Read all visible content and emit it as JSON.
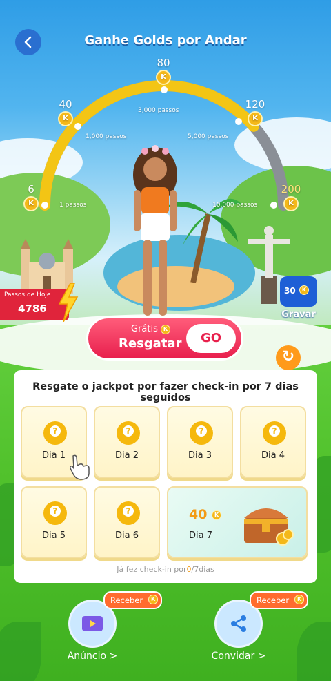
{
  "header": {
    "title": "Ganhe Golds por Andar"
  },
  "coin_symbol": "K",
  "milestones": [
    {
      "reward": "6",
      "steps": "1 passos"
    },
    {
      "reward": "40",
      "steps": "1,000 passos"
    },
    {
      "reward": "80",
      "steps": "3,000 passos"
    },
    {
      "reward": "120",
      "steps": "5,000 passos"
    },
    {
      "reward": "200",
      "steps": "10,000 passos"
    }
  ],
  "progress": {
    "fraction_of_arc": 0.77
  },
  "today": {
    "label": "Passos de Hoje",
    "value": "4786"
  },
  "record": {
    "reward": "30",
    "label": "Gravar"
  },
  "claim": {
    "free_label": "Grátis",
    "main_label": "Resgatar",
    "go_label": "GO"
  },
  "checkin": {
    "heading": "Resgate o jackpot por fazer check-in por 7 dias seguidos",
    "days": [
      "Dia 1",
      "Dia 2",
      "Dia 3",
      "Dia 4",
      "Dia 5",
      "Dia 6"
    ],
    "day7": {
      "label": "Dia 7",
      "reward": "40"
    },
    "footer_prefix": "Já fez check-in por",
    "footer_count": "0",
    "footer_suffix": "/7dias"
  },
  "bottom": {
    "ad": {
      "label": "Anúncio >",
      "badge": "Receber"
    },
    "invite": {
      "label": "Convidar >",
      "badge": "Receber"
    }
  },
  "colors": {
    "accent_red": "#e81f4d",
    "gold": "#f4b81a",
    "blue": "#1e5fd6"
  }
}
